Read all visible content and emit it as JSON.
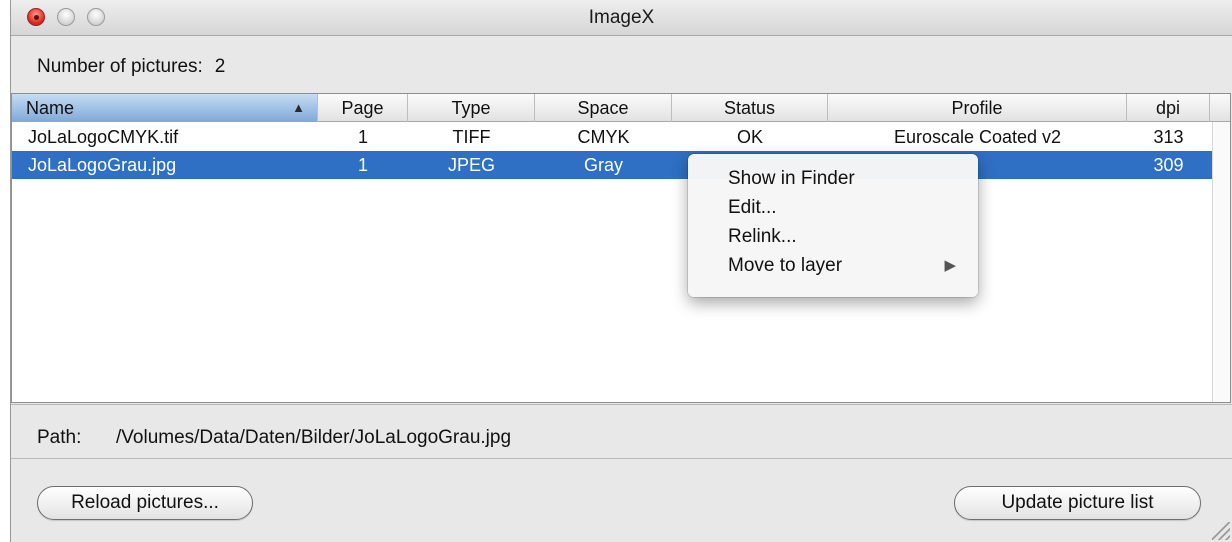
{
  "window": {
    "title": "ImageX"
  },
  "summary": {
    "label": "Number of pictures:",
    "count": "2"
  },
  "table": {
    "columns": [
      "Name",
      "Page",
      "Type",
      "Space",
      "Status",
      "Profile",
      "dpi"
    ],
    "sorted_column": "Name",
    "sort_direction": "ascending",
    "rows": [
      {
        "name": "JoLaLogoCMYK.tif",
        "page": "1",
        "type": "TIFF",
        "space": "CMYK",
        "status": "OK",
        "profile": "Euroscale Coated v2",
        "dpi": "313",
        "selected": false
      },
      {
        "name": "JoLaLogoGrau.jpg",
        "page": "1",
        "type": "JPEG",
        "space": "Gray",
        "status": "",
        "profile": "",
        "dpi": "309",
        "selected": true
      }
    ]
  },
  "context_menu": {
    "items": [
      "Show in Finder",
      "Edit...",
      "Relink...",
      "Move to layer"
    ]
  },
  "path": {
    "label": "Path:",
    "value": "/Volumes/Data/Daten/Bilder/JoLaLogoGrau.jpg"
  },
  "buttons": {
    "reload": "Reload pictures...",
    "update": "Update picture list"
  },
  "colors": {
    "selection": "#2f6fc4",
    "close_button": "#d4261c"
  }
}
